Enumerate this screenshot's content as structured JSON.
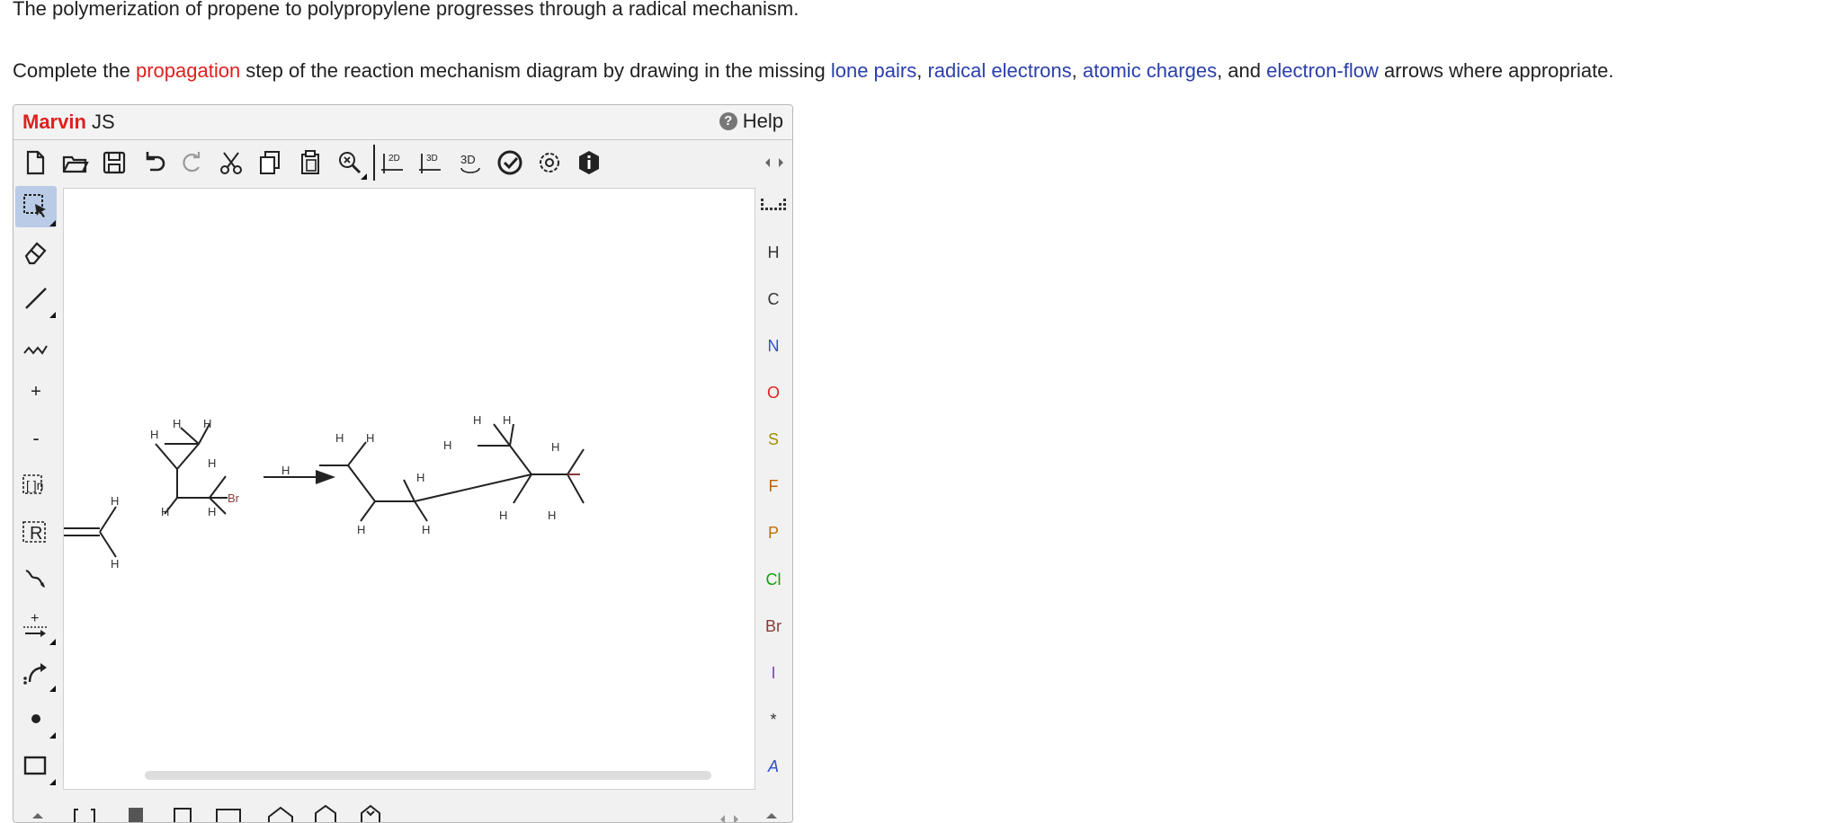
{
  "question": {
    "line1": "The polymerization of propene to polypropylene progresses through a radical mechanism.",
    "line2_pre": "Complete the ",
    "line2_propagation": "propagation",
    "line2_mid": " step of the reaction mechanism diagram by drawing in the missing ",
    "line2_lone_pairs": "lone pairs",
    "line2_comma1": ", ",
    "line2_radical": "radical electrons",
    "line2_comma2": ", ",
    "line2_charges": "atomic charges",
    "line2_and": ", and ",
    "line2_flow": "electron-flow",
    "line2_post": " arrows where appropriate."
  },
  "marvin": {
    "brand_main": "Marvin",
    "brand_suffix": " JS",
    "help_label": "Help",
    "help_glyph": "?"
  },
  "toolbar": {
    "icons": [
      "new-document-icon",
      "open-file-icon",
      "save-icon",
      "undo-icon",
      "redo-icon",
      "cut-icon",
      "copy-icon",
      "paste-icon",
      "zoom-icon",
      "clean-2d-icon",
      "clean-3d-icon",
      "view-3d-icon",
      "check-structure-icon",
      "settings-icon",
      "info-icon",
      "expand-arrows-icon"
    ],
    "label_2d": "2D",
    "label_3d": "3D",
    "label_3d_view": "3D"
  },
  "left_tools": {
    "icons": [
      "select-tool-icon",
      "erase-tool-icon",
      "single-bond-icon",
      "chain-tool-icon",
      "increase-charge-icon",
      "decrease-charge-icon",
      "bracket-tool-icon",
      "r-group-icon",
      "reaction-arrow-icon",
      "plus-tool-icon",
      "electron-flow-icon",
      "radical-icon",
      "rectangle-tool-icon"
    ],
    "increase_charge": "+",
    "decrease_charge": "-",
    "bracket_label": "[ ]n",
    "r_group_label": "R",
    "plus_label": "+"
  },
  "atoms": {
    "items": [
      {
        "symbol": "H",
        "color": "#333333"
      },
      {
        "symbol": "C",
        "color": "#333333"
      },
      {
        "symbol": "N",
        "color": "#3050c8"
      },
      {
        "symbol": "O",
        "color": "#e02020"
      },
      {
        "symbol": "S",
        "color": "#a09000"
      },
      {
        "symbol": "F",
        "color": "#c06000"
      },
      {
        "symbol": "P",
        "color": "#c07000"
      },
      {
        "symbol": "Cl",
        "color": "#10a010"
      },
      {
        "symbol": "Br",
        "color": "#8b3a3a"
      },
      {
        "symbol": "I",
        "color": "#8040c0"
      },
      {
        "symbol": "*",
        "color": "#333333"
      },
      {
        "symbol": "A",
        "color": "#3050c8"
      }
    ]
  },
  "molecule": {
    "h": "H",
    "br": "Br",
    "br_color": "#8b3a3a"
  }
}
